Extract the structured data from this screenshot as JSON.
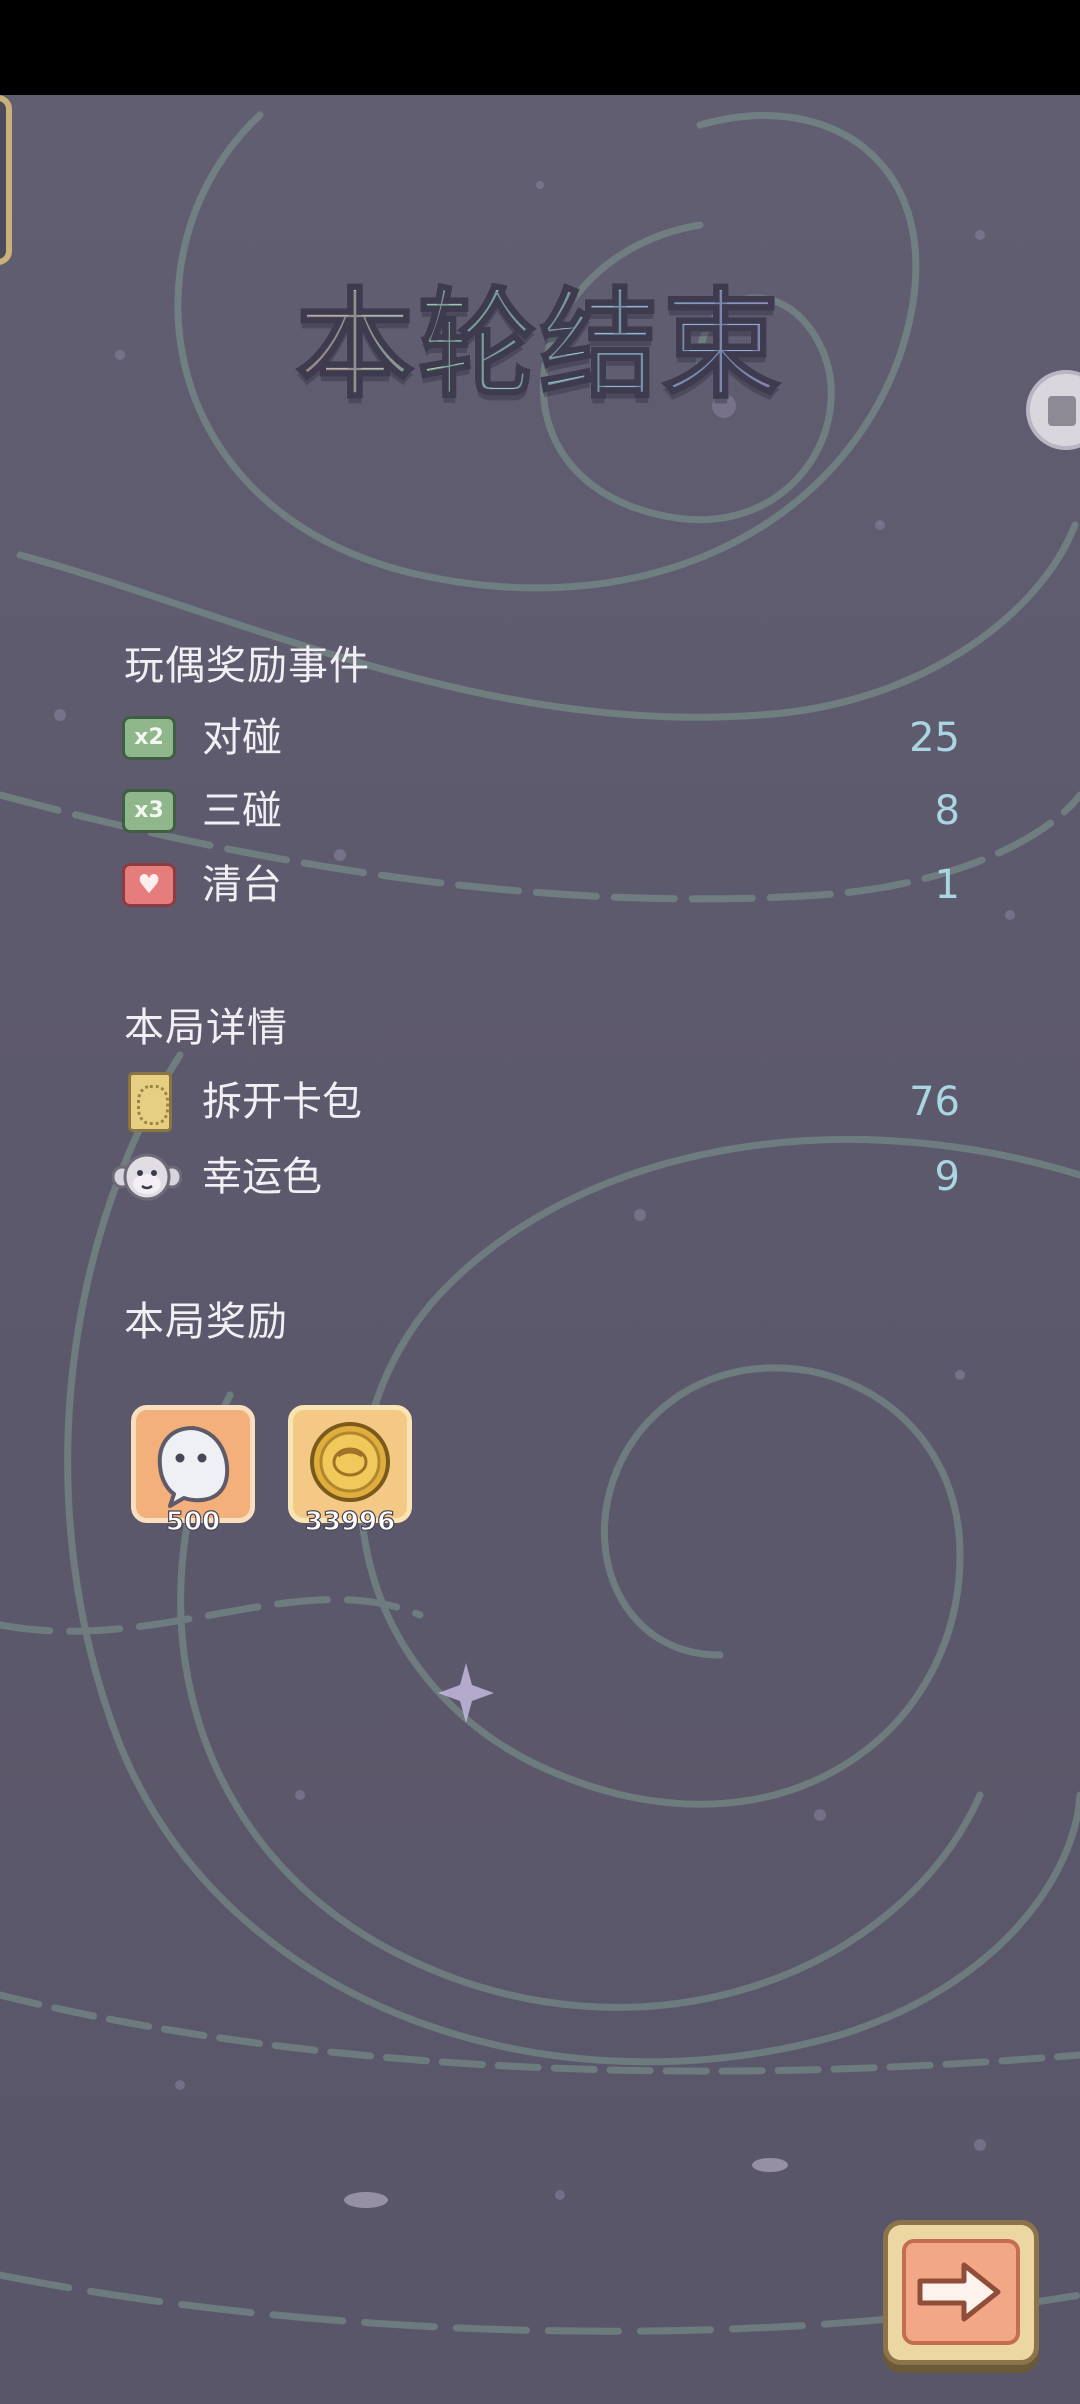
{
  "title": "本轮结束",
  "doll_events": {
    "heading": "玩偶奖励事件",
    "rows": [
      {
        "badge": "x2",
        "label": "对碰",
        "value": "25",
        "icon": "x2-badge-icon"
      },
      {
        "badge": "x3",
        "label": "三碰",
        "value": "8",
        "icon": "x3-badge-icon"
      },
      {
        "badge": "♥",
        "label": "清台",
        "value": "1",
        "icon": "heart-badge-icon"
      }
    ]
  },
  "round_details": {
    "heading": "本局详情",
    "rows": [
      {
        "label": "拆开卡包",
        "value": "76",
        "icon": "card-pack-icon"
      },
      {
        "label": "幸运色",
        "value": "9",
        "icon": "monkey-face-icon"
      }
    ]
  },
  "round_rewards": {
    "heading": "本局奖励",
    "items": [
      {
        "amount": "500",
        "icon": "ghost-speech-bubble-icon"
      },
      {
        "amount": "33996",
        "icon": "gold-coin-icon"
      }
    ]
  },
  "colors": {
    "background": "#5e5a6d",
    "swirl": "#7d9a90",
    "value_text": "#a9d6e2",
    "label_text": "#f1eef4"
  }
}
